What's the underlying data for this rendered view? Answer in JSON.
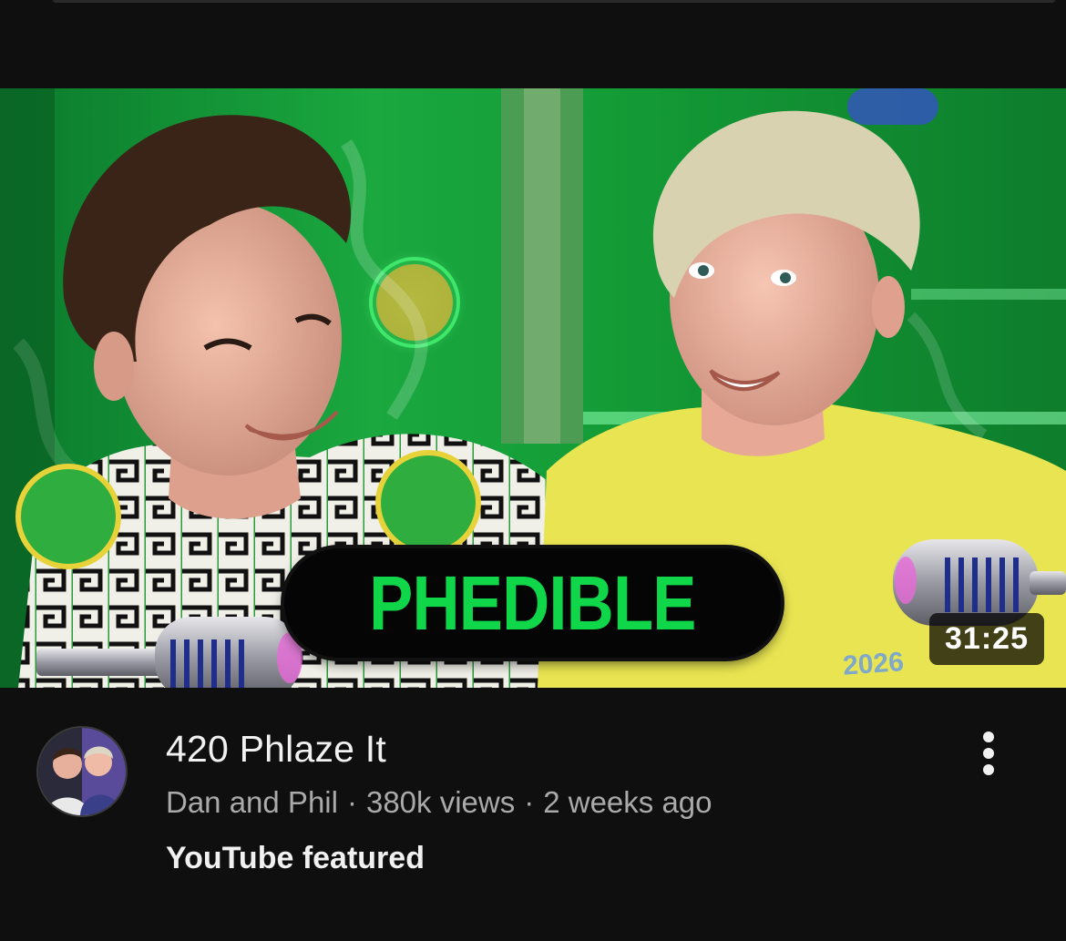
{
  "video": {
    "thumbnail_text": "PHEDIBLE",
    "thumbnail_subjects": "Two smiling men in front of a green studio backdrop with vintage microphones",
    "duration": "31:25",
    "title": "420 Phlaze It",
    "channel": "Dan and Phil",
    "views": "380k views",
    "age": "2 weeks ago",
    "separator": "·",
    "badge": "YouTube featured"
  },
  "icons": {
    "more": "more-vertical-icon",
    "avatar": "channel-avatar"
  },
  "colors": {
    "background": "#0f0f0f",
    "title_text": "#f1f1f1",
    "secondary_text": "#aaaaaa",
    "thumbnail_green": "#10d64a",
    "thumbnail_badge_bg": "#050505"
  }
}
